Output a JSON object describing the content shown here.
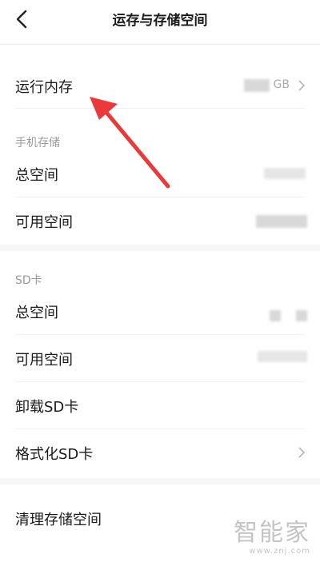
{
  "header": {
    "title": "运存与存储空间",
    "back_icon": "back-chevron-icon"
  },
  "running_memory": {
    "label": "运行内存",
    "unit": "GB"
  },
  "phone_storage": {
    "section_title": "手机存储",
    "total_label": "总空间",
    "available_label": "可用空间"
  },
  "sd_card": {
    "section_title": "SD卡",
    "total_label": "总空间",
    "available_label": "可用空间",
    "unmount_label": "卸载SD卡",
    "format_label": "格式化SD卡"
  },
  "cleanup": {
    "label": "清理存储空间"
  },
  "annotation": {
    "color": "#e8393b"
  },
  "watermark": {
    "name": "智能家",
    "url": "www.znj.com"
  }
}
